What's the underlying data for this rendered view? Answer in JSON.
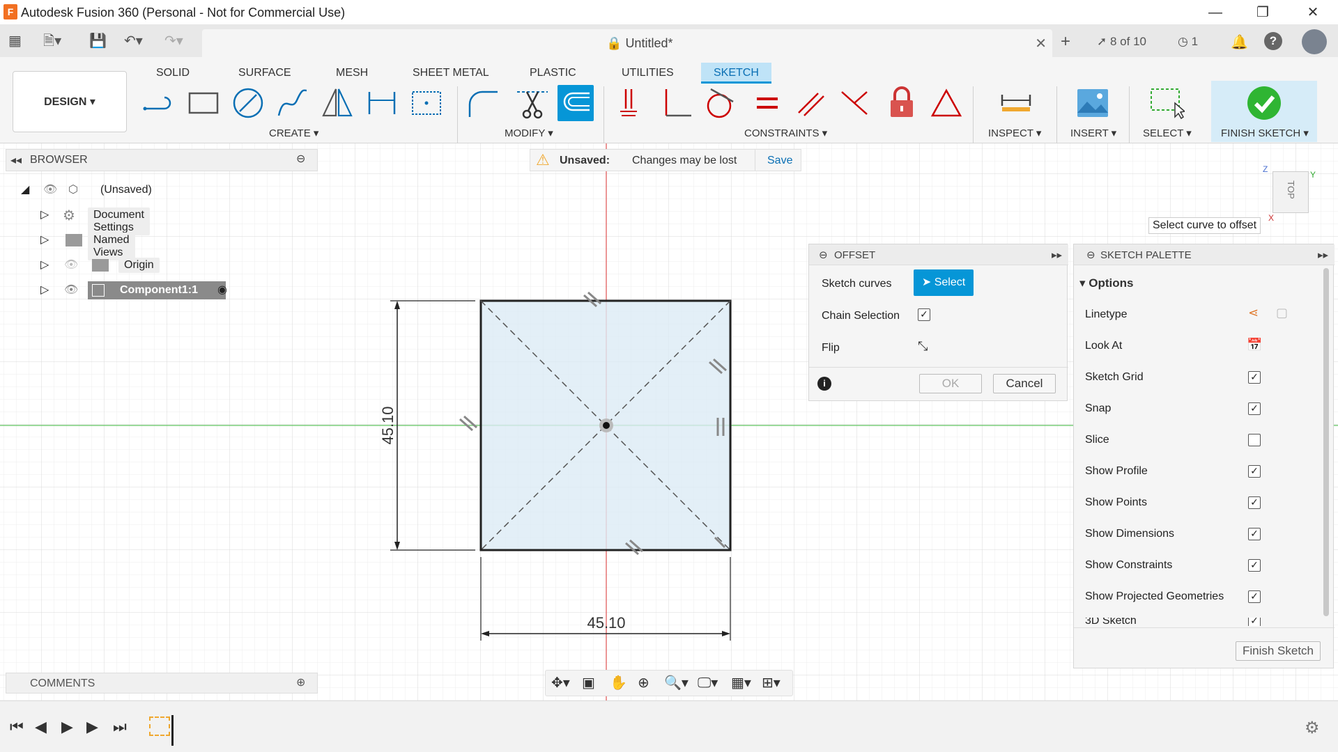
{
  "window": {
    "title": "Autodesk Fusion 360 (Personal - Not for Commercial Use)",
    "logo": "F"
  },
  "document": {
    "tab_title": "Untitled*",
    "job_count": "8 of 10",
    "clock_count": "1"
  },
  "workspace": {
    "label": "DESIGN ▾"
  },
  "ribbon": {
    "tabs": [
      "SOLID",
      "SURFACE",
      "MESH",
      "SHEET METAL",
      "PLASTIC",
      "UTILITIES",
      "SKETCH"
    ],
    "active_tab": "SKETCH",
    "groups": {
      "create": "CREATE ▾",
      "modify": "MODIFY ▾",
      "constraints": "CONSTRAINTS ▾",
      "inspect": "INSPECT ▾",
      "insert": "INSERT ▾",
      "select": "SELECT ▾",
      "finish": "FINISH SKETCH ▾"
    }
  },
  "browser": {
    "title": "BROWSER",
    "items": [
      {
        "label": "(Unsaved)"
      },
      {
        "label": "Document Settings"
      },
      {
        "label": "Named Views"
      },
      {
        "label": "Origin"
      },
      {
        "label": "Component1:1"
      }
    ]
  },
  "banner": {
    "status": "Unsaved:",
    "message": "Changes may be lost",
    "save": "Save"
  },
  "viewcube": {
    "face": "TOP",
    "z": "Z",
    "y": "Y",
    "x": "X"
  },
  "tooltip": "Select curve to offset",
  "offset": {
    "title": "OFFSET",
    "sketch_curves": "Sketch curves",
    "select": "Select",
    "chain_selection": "Chain Selection",
    "chain_checked": true,
    "flip": "Flip",
    "ok": "OK",
    "cancel": "Cancel"
  },
  "palette": {
    "title": "SKETCH PALETTE",
    "section": "Options",
    "rows": [
      {
        "label": "Linetype",
        "kind": "icons"
      },
      {
        "label": "Look At",
        "kind": "icon"
      },
      {
        "label": "Sketch Grid",
        "checked": true
      },
      {
        "label": "Snap",
        "checked": true
      },
      {
        "label": "Slice",
        "checked": false
      },
      {
        "label": "Show Profile",
        "checked": true
      },
      {
        "label": "Show Points",
        "checked": true
      },
      {
        "label": "Show Dimensions",
        "checked": true
      },
      {
        "label": "Show Constraints",
        "checked": true
      },
      {
        "label": "Show Projected Geometries",
        "checked": true
      },
      {
        "label": "3D Sketch",
        "checked": true
      }
    ],
    "finish_button": "Finish Sketch"
  },
  "sketch": {
    "dim_vertical": "45.10",
    "dim_horizontal": "45.10"
  },
  "comments": {
    "title": "COMMENTS"
  },
  "colors": {
    "accent": "#0696d7",
    "axis_red": "#e05050",
    "axis_green": "#5ec45e",
    "fill": "#dcebf5"
  }
}
